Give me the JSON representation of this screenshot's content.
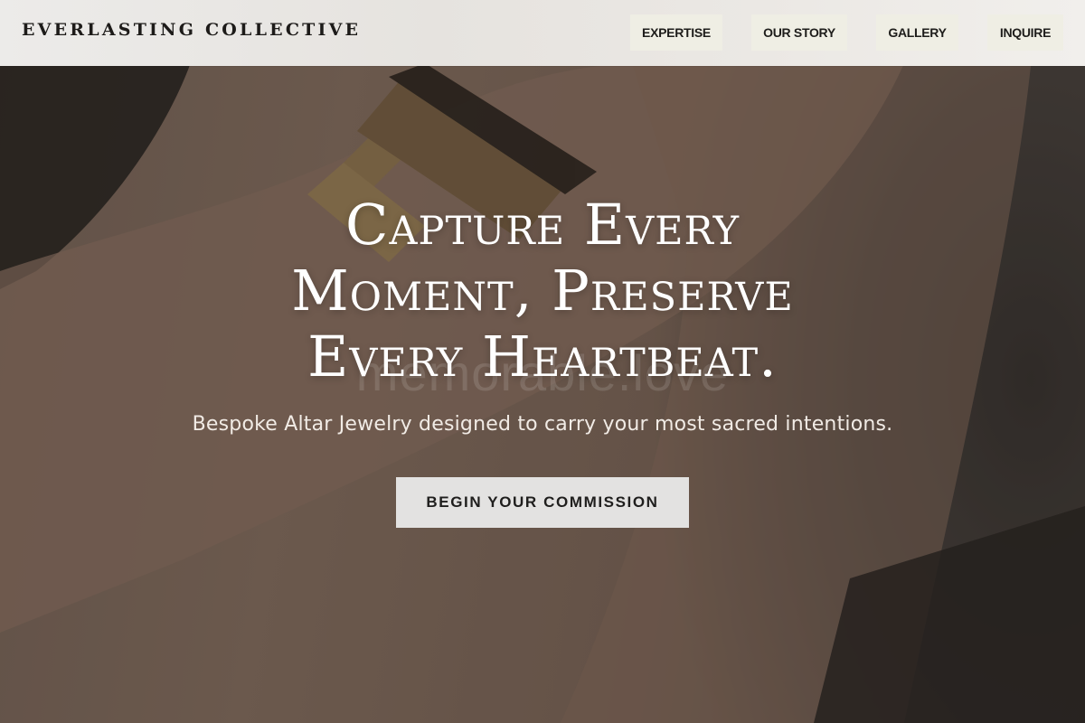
{
  "header": {
    "brand": "EVERLASTING COLLECTIVE",
    "nav": [
      {
        "label": "EXPERTISE"
      },
      {
        "label": "OUR STORY"
      },
      {
        "label": "GALLERY"
      },
      {
        "label": "INQUIRE"
      }
    ]
  },
  "hero": {
    "headline_lines": [
      "Capture Every",
      "Moment, Preserve",
      "Every Heartbeat."
    ],
    "watermark": "memorable.love",
    "subtitle": "Bespoke Altar Jewelry designed to carry your most sacred intentions.",
    "cta_label": "BEGIN YOUR COMMISSION"
  },
  "colors": {
    "header_bg": "#ecebe9",
    "nav_button_bg": "#efeee4",
    "cta_bg": "#e3e2e1",
    "text_dark": "#1d1b19",
    "hero_text": "#ffffff"
  }
}
